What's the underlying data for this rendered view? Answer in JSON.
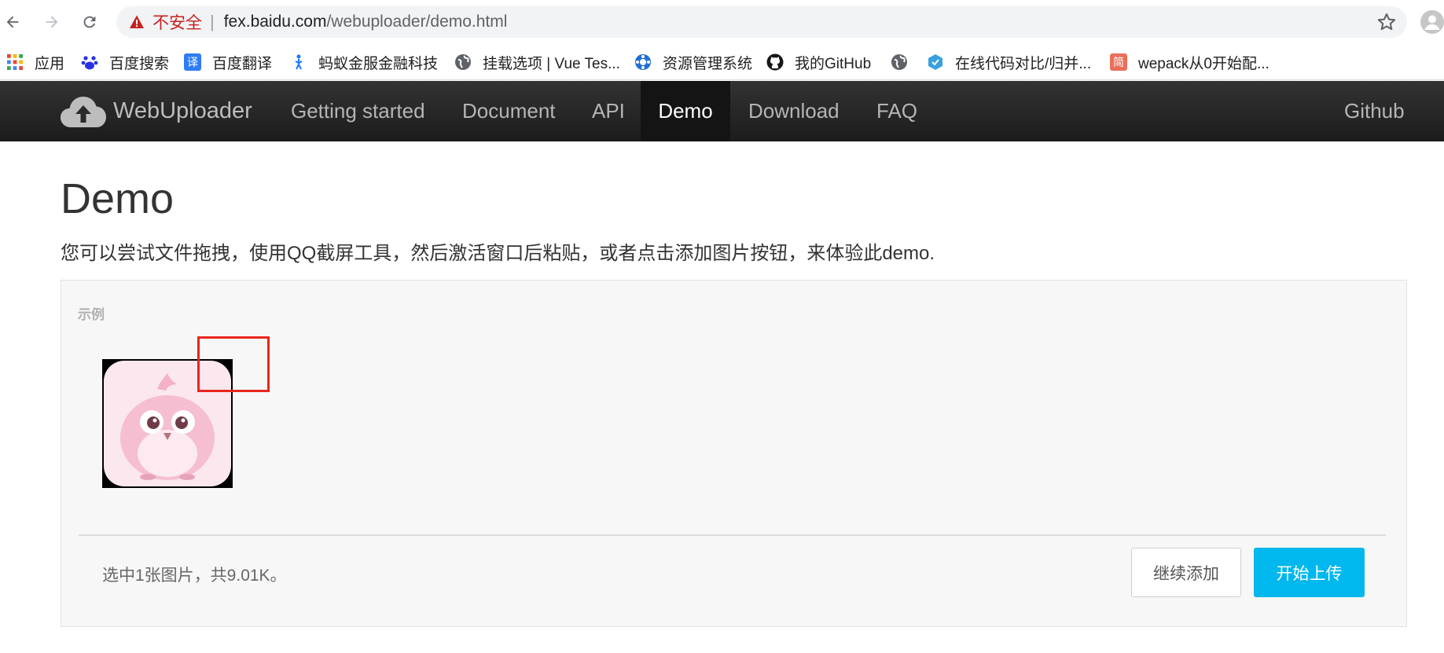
{
  "browser": {
    "insecure_label": "不安全",
    "url_host": "fex.baidu.com",
    "url_path": "/webuploader/demo.html",
    "accent_warning": "#c5221f"
  },
  "bookmarks": [
    {
      "label": "应用",
      "icon": "apps-grid-icon"
    },
    {
      "label": "百度搜索",
      "icon": "baidu-paw-icon"
    },
    {
      "label": "百度翻译",
      "icon": "translate-icon"
    },
    {
      "label": "蚂蚁金服金融科技",
      "icon": "ant-icon"
    },
    {
      "label": "挂载选项 | Vue Tes...",
      "icon": "globe-icon"
    },
    {
      "label": "资源管理系统",
      "icon": "resource-icon"
    },
    {
      "label": "我的GitHub",
      "icon": "github-icon"
    },
    {
      "label": "",
      "icon": "globe-icon"
    },
    {
      "label": "在线代码对比/归并...",
      "icon": "diff-icon"
    },
    {
      "label": "wepack从0开始配...",
      "icon": "jianshu-icon"
    }
  ],
  "site_nav": {
    "brand": "WebUploader",
    "items": [
      "Getting started",
      "Document",
      "API",
      "Demo",
      "Download",
      "FAQ"
    ],
    "active": "Demo",
    "right_link": "Github"
  },
  "page": {
    "title": "Demo",
    "description": "您可以尝试文件拖拽，使用QQ截屏工具，然后激活窗口后粘贴，或者点击添加图片按钮，来体验此demo."
  },
  "panel": {
    "label": "示例",
    "status": "选中1张图片，共9.01K。",
    "continue_button": "继续添加",
    "upload_button": "开始上传",
    "accent": "#00b7ee"
  }
}
